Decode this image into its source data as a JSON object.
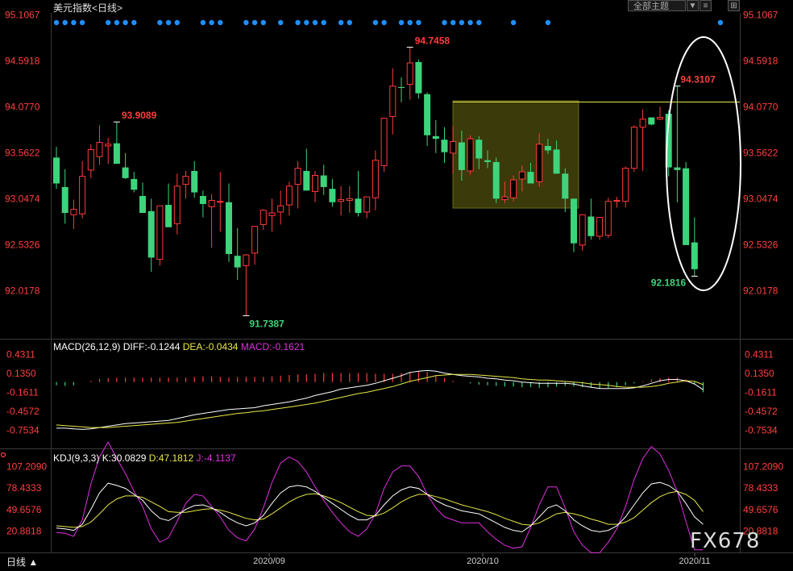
{
  "header": {
    "symbol": "美元指数",
    "period_tag": "<日线>",
    "theme_button": "全部主题",
    "controls": [
      "▼",
      "≡",
      "⊞"
    ]
  },
  "bottom": {
    "period": "日线 ▲",
    "logo": "FX678"
  },
  "price_axis": {
    "labels": [
      "95.1067",
      "94.5918",
      "94.0770",
      "93.5622",
      "93.0474",
      "92.5326",
      "92.0178"
    ]
  },
  "macd": {
    "name": "MACD(26,12,9)",
    "diff": "DIFF:-0.1244",
    "dea": "DEA:-0.0434",
    "macd": "MACD:-0.1621",
    "axis_labels": [
      "0.4311",
      "0.1350",
      "-0.1611",
      "-0.4572",
      "-0.7534"
    ]
  },
  "kdj": {
    "name": "KDJ(9,3,3)",
    "k": "K:30.0829",
    "d": "D:47.1812",
    "j": "J:-4.1137",
    "axis_labels": [
      "107.2090",
      "78.4333",
      "49.6576",
      "20.8818"
    ]
  },
  "x_axis": {
    "labels": [
      "2020/09",
      "2020/10",
      "2020/11"
    ]
  },
  "annotations": {
    "high1": "93.9089",
    "low1": "91.7387",
    "high2": "94.7458",
    "high3": "94.3107",
    "low2": "92.1816"
  },
  "colors": {
    "up": "#ff3b3b",
    "down": "#3ed47c",
    "dot": "#1e90ff",
    "yellow": "#e8e84a",
    "magenta": "#e030e0",
    "white": "#ffffff",
    "axis_red": "#ff4040"
  },
  "chart_data": {
    "type": "candlestick",
    "x_ticks": [
      "2020/09",
      "2020/10",
      "2020/11"
    ],
    "y_range": [
      91.55,
      95.18
    ],
    "candles": [
      {
        "o": 93.51,
        "h": 93.63,
        "l": 93.16,
        "c": 93.22
      },
      {
        "o": 93.18,
        "h": 93.38,
        "l": 92.77,
        "c": 92.89
      },
      {
        "o": 92.87,
        "h": 93.04,
        "l": 92.71,
        "c": 92.93
      },
      {
        "o": 92.88,
        "h": 93.47,
        "l": 92.83,
        "c": 93.3
      },
      {
        "o": 93.37,
        "h": 93.66,
        "l": 93.28,
        "c": 93.6
      },
      {
        "o": 93.52,
        "h": 93.87,
        "l": 93.43,
        "c": 93.68
      },
      {
        "o": 93.64,
        "h": 93.73,
        "l": 93.44,
        "c": 93.66
      },
      {
        "o": 93.67,
        "h": 93.91,
        "l": 93.54,
        "c": 93.44
      },
      {
        "o": 93.4,
        "h": 93.56,
        "l": 93.27,
        "c": 93.28
      },
      {
        "o": 93.27,
        "h": 93.35,
        "l": 93.12,
        "c": 93.15
      },
      {
        "o": 93.08,
        "h": 93.23,
        "l": 92.9,
        "c": 92.89
      },
      {
        "o": 92.91,
        "h": 93.05,
        "l": 92.23,
        "c": 92.39
      },
      {
        "o": 92.37,
        "h": 92.97,
        "l": 92.3,
        "c": 92.97
      },
      {
        "o": 92.98,
        "h": 93.22,
        "l": 92.74,
        "c": 92.73
      },
      {
        "o": 92.77,
        "h": 93.33,
        "l": 92.65,
        "c": 93.19
      },
      {
        "o": 93.21,
        "h": 93.36,
        "l": 93.05,
        "c": 93.3
      },
      {
        "o": 93.36,
        "h": 93.47,
        "l": 93.06,
        "c": 93.12
      },
      {
        "o": 93.08,
        "h": 93.14,
        "l": 92.84,
        "c": 92.99
      },
      {
        "o": 92.96,
        "h": 93.1,
        "l": 92.5,
        "c": 93.03
      },
      {
        "o": 93.01,
        "h": 93.35,
        "l": 92.68,
        "c": 93.02
      },
      {
        "o": 93.01,
        "h": 93.22,
        "l": 92.34,
        "c": 92.43
      },
      {
        "o": 92.41,
        "h": 92.72,
        "l": 92.14,
        "c": 92.28
      },
      {
        "o": 92.3,
        "h": 92.43,
        "l": 91.74,
        "c": 92.42
      },
      {
        "o": 92.44,
        "h": 92.66,
        "l": 92.31,
        "c": 92.74
      },
      {
        "o": 92.76,
        "h": 92.93,
        "l": 92.7,
        "c": 92.92
      },
      {
        "o": 92.86,
        "h": 93.05,
        "l": 92.68,
        "c": 92.89
      },
      {
        "o": 92.9,
        "h": 93.14,
        "l": 92.76,
        "c": 92.97
      },
      {
        "o": 92.98,
        "h": 93.24,
        "l": 92.86,
        "c": 93.19
      },
      {
        "o": 93.21,
        "h": 93.47,
        "l": 92.94,
        "c": 93.39
      },
      {
        "o": 93.36,
        "h": 93.61,
        "l": 93.21,
        "c": 93.14
      },
      {
        "o": 93.13,
        "h": 93.36,
        "l": 93.01,
        "c": 93.31
      },
      {
        "o": 93.31,
        "h": 93.43,
        "l": 93.09,
        "c": 93.18
      },
      {
        "o": 93.16,
        "h": 93.27,
        "l": 92.96,
        "c": 93.01
      },
      {
        "o": 93.02,
        "h": 93.19,
        "l": 92.86,
        "c": 93.04
      },
      {
        "o": 93.03,
        "h": 93.19,
        "l": 92.89,
        "c": 93.05
      },
      {
        "o": 93.05,
        "h": 93.36,
        "l": 92.85,
        "c": 92.89
      },
      {
        "o": 92.9,
        "h": 93.06,
        "l": 92.83,
        "c": 93.07
      },
      {
        "o": 93.06,
        "h": 93.59,
        "l": 92.92,
        "c": 93.48
      },
      {
        "o": 93.42,
        "h": 93.94,
        "l": 93.35,
        "c": 93.95
      },
      {
        "o": 93.97,
        "h": 94.51,
        "l": 93.77,
        "c": 94.31
      },
      {
        "o": 94.3,
        "h": 94.41,
        "l": 94.13,
        "c": 94.29
      },
      {
        "o": 94.33,
        "h": 94.75,
        "l": 94.16,
        "c": 94.57
      },
      {
        "o": 94.58,
        "h": 94.61,
        "l": 94.17,
        "c": 94.23
      },
      {
        "o": 94.22,
        "h": 94.24,
        "l": 93.64,
        "c": 93.76
      },
      {
        "o": 93.75,
        "h": 93.93,
        "l": 93.56,
        "c": 93.72
      },
      {
        "o": 93.71,
        "h": 93.85,
        "l": 93.45,
        "c": 93.57
      },
      {
        "o": 93.56,
        "h": 93.86,
        "l": 93.33,
        "c": 93.69
      },
      {
        "o": 93.68,
        "h": 93.81,
        "l": 93.25,
        "c": 93.37
      },
      {
        "o": 93.36,
        "h": 93.76,
        "l": 93.32,
        "c": 93.72
      },
      {
        "o": 93.71,
        "h": 93.75,
        "l": 93.38,
        "c": 93.5
      },
      {
        "o": 93.48,
        "h": 93.59,
        "l": 93.39,
        "c": 93.46
      },
      {
        "o": 93.46,
        "h": 93.51,
        "l": 93.0,
        "c": 93.05
      },
      {
        "o": 93.04,
        "h": 93.24,
        "l": 93.0,
        "c": 93.07
      },
      {
        "o": 93.06,
        "h": 93.31,
        "l": 93.02,
        "c": 93.26
      },
      {
        "o": 93.27,
        "h": 93.42,
        "l": 93.13,
        "c": 93.35
      },
      {
        "o": 93.35,
        "h": 93.45,
        "l": 93.24,
        "c": 93.22
      },
      {
        "o": 93.24,
        "h": 93.78,
        "l": 93.18,
        "c": 93.66
      },
      {
        "o": 93.64,
        "h": 93.72,
        "l": 93.55,
        "c": 93.59
      },
      {
        "o": 93.6,
        "h": 93.7,
        "l": 93.33,
        "c": 93.33
      },
      {
        "o": 93.33,
        "h": 93.39,
        "l": 92.9,
        "c": 93.05
      },
      {
        "o": 93.05,
        "h": 93.05,
        "l": 92.45,
        "c": 92.55
      },
      {
        "o": 92.53,
        "h": 92.77,
        "l": 92.47,
        "c": 92.87
      },
      {
        "o": 92.85,
        "h": 93.05,
        "l": 92.59,
        "c": 92.63
      },
      {
        "o": 92.63,
        "h": 92.82,
        "l": 92.59,
        "c": 92.84
      },
      {
        "o": 92.64,
        "h": 93.06,
        "l": 92.61,
        "c": 93.02
      },
      {
        "o": 93.02,
        "h": 93.07,
        "l": 92.95,
        "c": 93.03
      },
      {
        "o": 93.02,
        "h": 93.41,
        "l": 92.95,
        "c": 93.39
      },
      {
        "o": 93.39,
        "h": 93.87,
        "l": 93.35,
        "c": 93.85
      },
      {
        "o": 93.85,
        "h": 94.05,
        "l": 93.36,
        "c": 93.94
      },
      {
        "o": 93.96,
        "h": 93.96,
        "l": 93.87,
        "c": 93.88
      },
      {
        "o": 93.94,
        "h": 94.08,
        "l": 93.93,
        "c": 93.96
      },
      {
        "o": 94.0,
        "h": 94.04,
        "l": 93.3,
        "c": 93.4
      },
      {
        "o": 93.4,
        "h": 94.31,
        "l": 93.01,
        "c": 93.37
      },
      {
        "o": 93.39,
        "h": 93.46,
        "l": 92.54,
        "c": 92.53
      },
      {
        "o": 92.56,
        "h": 92.84,
        "l": 92.18,
        "c": 92.26
      }
    ],
    "macd": {
      "bars": [
        -0.05,
        -0.06,
        -0.05,
        0.0,
        0.02,
        0.05,
        0.06,
        0.07,
        0.07,
        0.07,
        0.07,
        0.07,
        0.07,
        0.07,
        0.07,
        0.07,
        0.08,
        0.09,
        0.09,
        0.08,
        0.07,
        0.08,
        0.08,
        0.08,
        0.08,
        0.09,
        0.1,
        0.11,
        0.12,
        0.12,
        0.13,
        0.14,
        0.14,
        0.14,
        0.14,
        0.14,
        0.14,
        0.13,
        0.13,
        0.13,
        0.14,
        0.16,
        0.17,
        0.16,
        0.11,
        0.06,
        0.02,
        0.0,
        -0.02,
        -0.04,
        -0.05,
        -0.06,
        -0.07,
        -0.07,
        -0.08,
        -0.08,
        -0.09,
        -0.08,
        -0.07,
        -0.06,
        -0.07,
        -0.08,
        -0.09,
        -0.1,
        -0.09,
        -0.08,
        -0.05,
        -0.02,
        0.01,
        0.04,
        0.06,
        0.07,
        0.07,
        0.04,
        -0.03,
        -0.16
      ],
      "diff": [
        -0.72,
        -0.72,
        -0.73,
        -0.74,
        -0.73,
        -0.71,
        -0.69,
        -0.67,
        -0.65,
        -0.64,
        -0.63,
        -0.62,
        -0.61,
        -0.6,
        -0.57,
        -0.54,
        -0.51,
        -0.49,
        -0.47,
        -0.45,
        -0.43,
        -0.42,
        -0.41,
        -0.4,
        -0.37,
        -0.35,
        -0.33,
        -0.31,
        -0.28,
        -0.25,
        -0.21,
        -0.18,
        -0.15,
        -0.11,
        -0.09,
        -0.07,
        -0.05,
        -0.02,
        0.02,
        0.06,
        0.1,
        0.15,
        0.17,
        0.18,
        0.17,
        0.14,
        0.12,
        0.1,
        0.09,
        0.08,
        0.06,
        0.05,
        0.03,
        0.02,
        0.0,
        -0.01,
        -0.02,
        -0.02,
        -0.02,
        -0.02,
        -0.03,
        -0.06,
        -0.08,
        -0.1,
        -0.1,
        -0.1,
        -0.1,
        -0.09,
        -0.06,
        -0.02,
        0.02,
        0.04,
        0.04,
        0.02,
        -0.03,
        -0.12
      ],
      "dea": [
        -0.67,
        -0.68,
        -0.69,
        -0.7,
        -0.71,
        -0.71,
        -0.71,
        -0.7,
        -0.69,
        -0.68,
        -0.67,
        -0.66,
        -0.65,
        -0.64,
        -0.63,
        -0.61,
        -0.59,
        -0.57,
        -0.55,
        -0.53,
        -0.51,
        -0.49,
        -0.48,
        -0.46,
        -0.45,
        -0.43,
        -0.41,
        -0.39,
        -0.37,
        -0.35,
        -0.33,
        -0.3,
        -0.27,
        -0.24,
        -0.21,
        -0.18,
        -0.16,
        -0.13,
        -0.1,
        -0.07,
        -0.03,
        0.01,
        0.04,
        0.07,
        0.1,
        0.11,
        0.12,
        0.12,
        0.12,
        0.11,
        0.1,
        0.09,
        0.08,
        0.07,
        0.05,
        0.04,
        0.03,
        0.03,
        0.02,
        0.01,
        0.0,
        -0.01,
        -0.03,
        -0.04,
        -0.05,
        -0.07,
        -0.08,
        -0.08,
        -0.08,
        -0.07,
        -0.05,
        -0.02,
        0.0,
        0.02,
        0.01,
        -0.04
      ]
    },
    "kdj": {
      "k": [
        25,
        24,
        22,
        30,
        50,
        72,
        85,
        82,
        78,
        70,
        62,
        48,
        38,
        35,
        42,
        50,
        55,
        56,
        52,
        46,
        38,
        32,
        28,
        32,
        42,
        58,
        72,
        80,
        82,
        80,
        74,
        66,
        58,
        50,
        42,
        36,
        36,
        42,
        56,
        68,
        76,
        80,
        78,
        70,
        62,
        56,
        52,
        48,
        46,
        44,
        38,
        32,
        26,
        22,
        20,
        28,
        40,
        52,
        56,
        48,
        36,
        28,
        22,
        20,
        22,
        28,
        40,
        56,
        72,
        84,
        86,
        82,
        74,
        58,
        40,
        30
      ],
      "d": [
        28,
        27,
        26,
        27,
        33,
        44,
        56,
        64,
        68,
        68,
        66,
        60,
        54,
        47,
        46,
        46,
        48,
        50,
        51,
        49,
        46,
        42,
        38,
        36,
        37,
        44,
        52,
        60,
        66,
        70,
        71,
        68,
        64,
        59,
        53,
        47,
        42,
        41,
        45,
        52,
        60,
        66,
        70,
        70,
        67,
        64,
        60,
        56,
        53,
        50,
        47,
        43,
        38,
        34,
        30,
        29,
        32,
        38,
        44,
        46,
        44,
        41,
        37,
        34,
        30,
        30,
        33,
        39,
        49,
        59,
        67,
        72,
        74,
        70,
        62,
        47
      ],
      "j": [
        19,
        18,
        14,
        36,
        84,
        120,
        140,
        118,
        98,
        74,
        54,
        24,
        6,
        12,
        34,
        58,
        70,
        68,
        54,
        40,
        22,
        12,
        8,
        24,
        52,
        86,
        112,
        120,
        114,
        100,
        80,
        62,
        46,
        32,
        20,
        14,
        24,
        44,
        78,
        100,
        108,
        108,
        94,
        70,
        52,
        40,
        36,
        32,
        32,
        32,
        20,
        10,
        2,
        -2,
        0,
        26,
        56,
        80,
        80,
        52,
        20,
        2,
        -8,
        -8,
        6,
        24,
        54,
        90,
        118,
        134,
        124,
        102,
        74,
        34,
        -4,
        -4
      ]
    }
  }
}
